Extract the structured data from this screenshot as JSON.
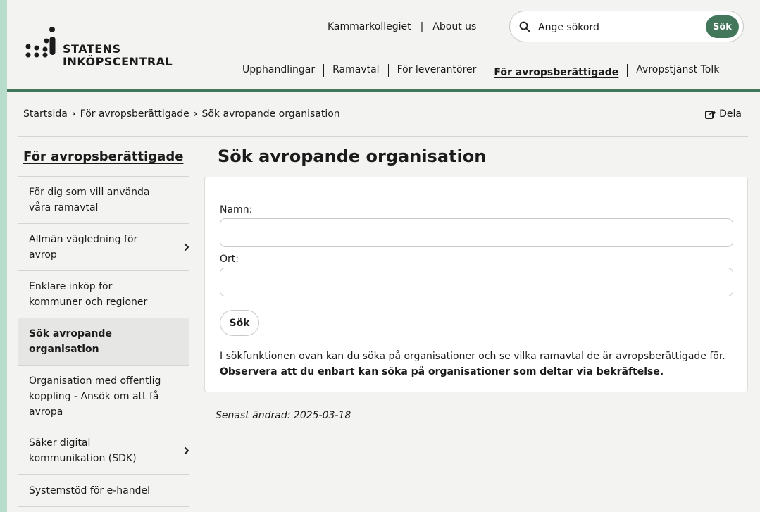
{
  "logo": {
    "line1": "STATENS",
    "line2": "INKÖPSCENTRAL"
  },
  "topnav": {
    "link1": "Kammarkollegiet",
    "link2": "About us"
  },
  "search": {
    "placeholder": "Ange sökord",
    "button": "Sök"
  },
  "mainnav": [
    "Upphandlingar",
    "Ramavtal",
    "För leverantörer",
    "För avropsberättigade",
    "Avropstjänst Tolk"
  ],
  "breadcrumb": [
    "Startsida",
    "För avropsberättigade",
    "Sök avropande organisation"
  ],
  "share": "Dela",
  "sidebar": {
    "title": "För avropsberättigade",
    "items": [
      {
        "label": "För dig som vill använda våra ramavtal"
      },
      {
        "label": "Allmän vägledning för avrop"
      },
      {
        "label": "Enklare inköp för kommuner och regioner"
      },
      {
        "label": "Sök avropande organisation"
      },
      {
        "label": "Organisation med offentlig koppling - Ansök om att få avropa"
      },
      {
        "label": "Säker digital kommunikation (SDK)"
      },
      {
        "label": "Systemstöd för e-handel"
      }
    ]
  },
  "main": {
    "title": "Sök avropande organisation",
    "name_label": "Namn:",
    "city_label": "Ort:",
    "submit": "Sök",
    "info": "I sökfunktionen ovan kan du söka på organisationer och se vilka ramavtal de är avropsberättigade för.",
    "info_bold": "Observera att du enbart kan söka på organisationer som deltar via bekräftelse.",
    "updated": "Senast ändrad: 2025-03-18"
  },
  "colors": {
    "brand": "#43775b",
    "background": "#f3f3f2",
    "frame": "#b8dccb"
  }
}
